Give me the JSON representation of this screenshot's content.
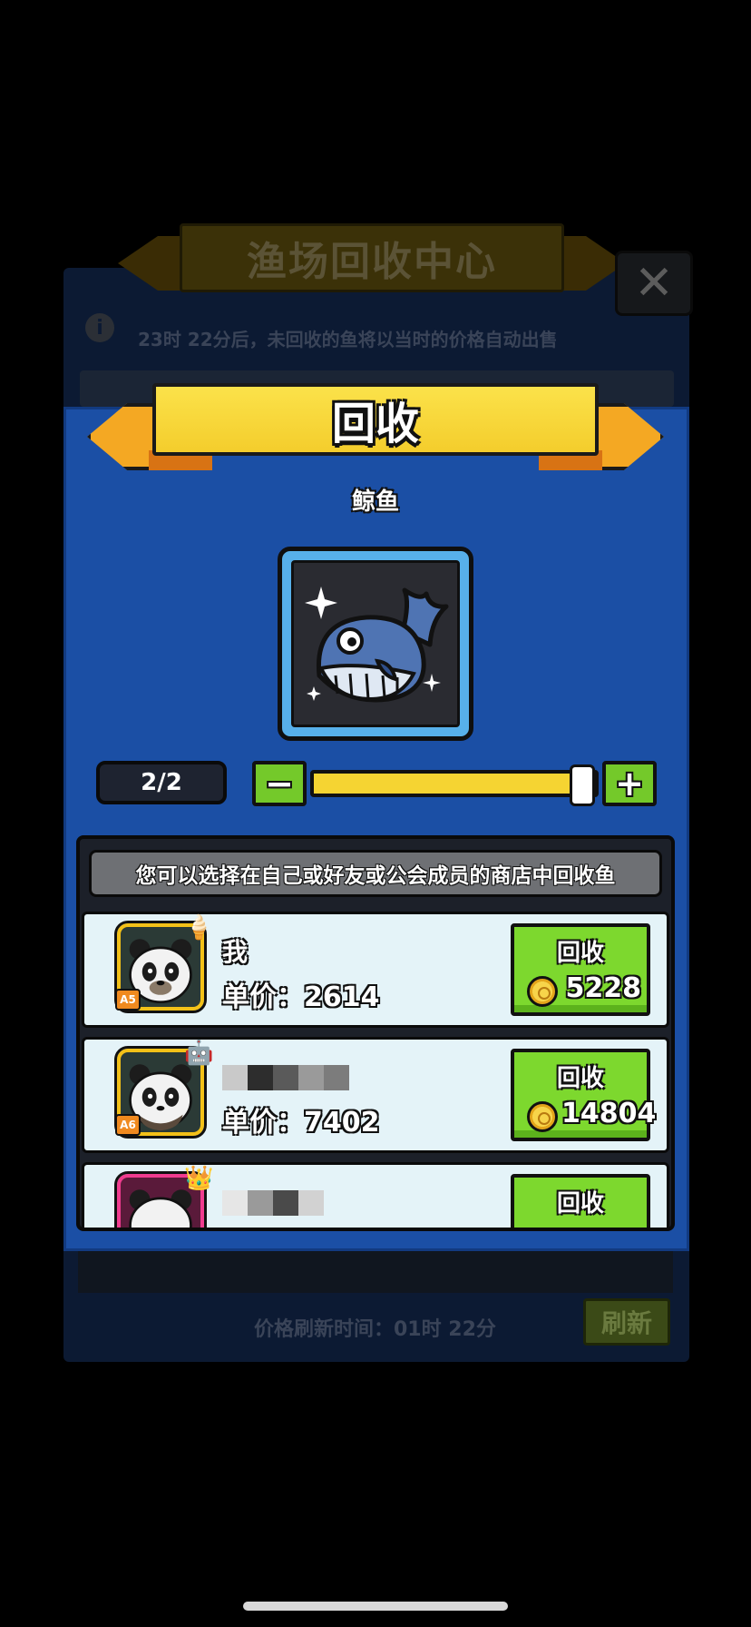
{
  "background": {
    "title": "渔场回收中心",
    "close_glyph": "✕",
    "info_glyph": "i",
    "notice": "23时 22分后，未回收的鱼将以当时的价格自动出售",
    "refresh_time": "价格刷新时间：01时 22分",
    "refresh_button": "刷新"
  },
  "dialog": {
    "title": "回收",
    "fish_name": "鲸鱼",
    "fish_icon": "whale-icon",
    "count": "2/2",
    "minus_glyph": "−",
    "plus_glyph": "+",
    "slider_value": 1.0,
    "hint": "您可以选择在自己或好友或公会成员的商店中回收鱼",
    "rows": [
      {
        "name": "我",
        "rank": "A5",
        "badge": "🍦",
        "price": "单价：2614",
        "button": "回收",
        "total": "5228"
      },
      {
        "rank": "A6",
        "badge": "🤖",
        "price": "单价：7402",
        "button": "回收",
        "total": "14804"
      },
      {
        "badge": "👑",
        "button": "回收"
      }
    ]
  },
  "colors": {
    "dialog_bg": "#1b4fa5",
    "banner_yellow": "#f4cd2c",
    "button_green": "#7dd82e",
    "row_bg": "#e4f3f8"
  }
}
